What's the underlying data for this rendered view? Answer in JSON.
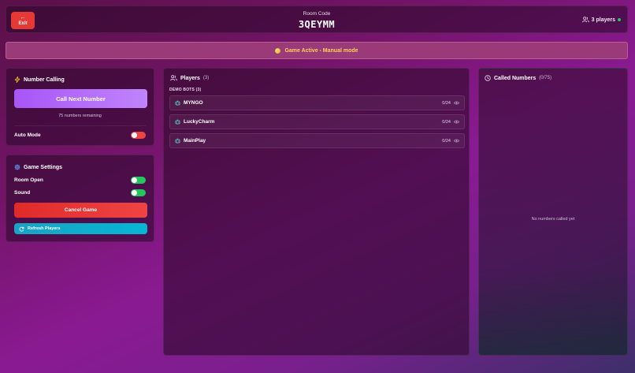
{
  "header": {
    "exit_label": "Exit",
    "room_code_label": "Room Code",
    "room_code": "3QEYMM",
    "players_label": "3 players"
  },
  "banner": {
    "text": "Game Active - Manual mode"
  },
  "number_calling": {
    "title": "Number Calling",
    "call_button": "Call Next Number",
    "remaining_text": "75 numbers remaining",
    "auto_mode_label": "Auto Mode",
    "auto_mode_on": false
  },
  "game_settings": {
    "title": "Game Settings",
    "room_open_label": "Room Open",
    "room_open_on": true,
    "sound_label": "Sound",
    "sound_on": true,
    "cancel_button": "Cancel Game",
    "refresh_button": "Refresh Players"
  },
  "players": {
    "title": "Players",
    "count": "(3)",
    "group_label": "DEMO BOTS (3)",
    "list": [
      {
        "name": "MYNGO",
        "score": "0/24"
      },
      {
        "name": "LuckyCharm",
        "score": "0/24"
      },
      {
        "name": "MainPlay",
        "score": "0/24"
      }
    ]
  },
  "called_numbers": {
    "title": "Called Numbers",
    "count": "(0/75)",
    "empty_text": "No numbers called yet"
  },
  "colors": {
    "accent_purple": "#a855f7",
    "danger": "#ef4444",
    "success": "#22c55e",
    "info": "#06b6d4",
    "banner_text": "#ffd25a"
  }
}
